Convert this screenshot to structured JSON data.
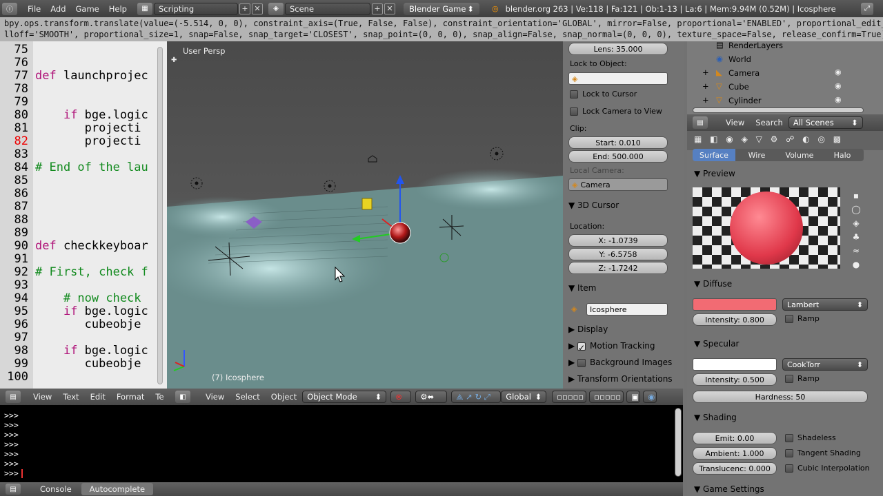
{
  "topbar": {
    "menus": [
      "File",
      "Add",
      "Game",
      "Help"
    ],
    "screen_layout": "Scripting",
    "scene": "Scene",
    "engine": "Blender Game",
    "stats": "blender.org 263 | Ve:118 | Fa:121 | Ob:1-13 | La:6 | Mem:9.94M (0.52M) | Icosphere"
  },
  "infolog": {
    "lines": [
      "bpy.ops.transform.translate(value=(-5.514, 0, 0), constraint_axis=(True, False, False), constraint_orientation='GLOBAL', mirror=False, proportional='ENABLED', proportional_edit_fa",
      "lloff='SMOOTH', proportional_size=1, snap=False, snap_target='CLOSEST', snap_point=(0, 0, 0), snap_align=False, snap_normal=(0, 0, 0), texture_space=False, release_confirm=True)"
    ]
  },
  "text_editor": {
    "lines": [
      {
        "n": "75",
        "code": "",
        "cls": "txt"
      },
      {
        "n": "76",
        "code": "",
        "cls": "txt"
      },
      {
        "n": "77",
        "code": "def launchprojec",
        "cls": "def"
      },
      {
        "n": "78",
        "code": "",
        "cls": "txt"
      },
      {
        "n": "79",
        "code": "",
        "cls": "txt"
      },
      {
        "n": "80",
        "code": "    if bge.logic",
        "cls": "if"
      },
      {
        "n": "81",
        "code": "       projecti",
        "cls": "txt"
      },
      {
        "n": "82",
        "code": "       projecti",
        "cls": "txt"
      },
      {
        "n": "83",
        "code": "",
        "cls": "txt"
      },
      {
        "n": "84",
        "code": "# End of the lau",
        "cls": "cm"
      },
      {
        "n": "85",
        "code": "",
        "cls": "txt"
      },
      {
        "n": "86",
        "code": "",
        "cls": "txt"
      },
      {
        "n": "87",
        "code": "",
        "cls": "txt"
      },
      {
        "n": "88",
        "code": "",
        "cls": "txt"
      },
      {
        "n": "89",
        "code": "",
        "cls": "txt"
      },
      {
        "n": "90",
        "code": "def checkkeyboar",
        "cls": "def"
      },
      {
        "n": "91",
        "code": "",
        "cls": "txt"
      },
      {
        "n": "92",
        "code": "# First, check f",
        "cls": "cm"
      },
      {
        "n": "93",
        "code": "",
        "cls": "txt"
      },
      {
        "n": "94",
        "code": "    # now check",
        "cls": "cm"
      },
      {
        "n": "95",
        "code": "    if bge.logic",
        "cls": "if"
      },
      {
        "n": "96",
        "code": "       cubeobje",
        "cls": "txt"
      },
      {
        "n": "97",
        "code": "",
        "cls": "txt"
      },
      {
        "n": "98",
        "code": "    if bge.logic",
        "cls": "if"
      },
      {
        "n": "99",
        "code": "       cubeobje",
        "cls": "txt"
      },
      {
        "n": "100",
        "code": "",
        "cls": "txt"
      }
    ],
    "error_line": "82",
    "header_menus": [
      "View",
      "Text",
      "Edit",
      "Format",
      "Te"
    ]
  },
  "viewport": {
    "label": "User Persp",
    "object_label": "(7) Icosphere",
    "header_menus": [
      "View",
      "Select",
      "Object"
    ],
    "mode": "Object Mode",
    "orientation": "Global"
  },
  "npanel": {
    "lens": "Lens: 35.000",
    "lock_to_object": "Lock to Object:",
    "lock_to_cursor": "Lock to Cursor",
    "lock_camera": "Lock Camera to View",
    "clip": "Clip:",
    "clip_start": "Start: 0.010",
    "clip_end": "End: 500.000",
    "local_camera": "Local Camera:",
    "camera": "Camera",
    "cursor_header": "3D Cursor",
    "location": "Location:",
    "x": "X: -1.0739",
    "y": "Y: -6.5758",
    "z": "Z: -1.7242",
    "item_header": "Item",
    "item_name": "Icosphere",
    "display": "Display",
    "motion_tracking": "Motion Tracking",
    "background_images": "Background Images",
    "transform_orientations": "Transform Orientations"
  },
  "outliner": {
    "rows": [
      "RenderLayers",
      "World",
      "Camera",
      "Cube",
      "Cylinder"
    ],
    "header_menus": [
      "View",
      "Search"
    ],
    "filter": "All Scenes"
  },
  "properties": {
    "tabs": [
      "Surface",
      "Wire",
      "Volume",
      "Halo"
    ],
    "preview": "Preview",
    "diffuse": "Diffuse",
    "diffuse_color": "#f26b73",
    "diffuse_shader": "Lambert",
    "diffuse_intensity": "Intensity: 0.800",
    "ramp": "Ramp",
    "specular": "Specular",
    "specular_shader": "CookTorr",
    "specular_intensity": "Intensity: 0.500",
    "hardness": "Hardness: 50",
    "shading": "Shading",
    "emit": "Emit: 0.00",
    "ambient": "Ambient: 1.000",
    "translucency": "Translucenc: 0.000",
    "shadeless": "Shadeless",
    "tangent_shading": "Tangent Shading",
    "cubic_interpolation": "Cubic Interpolation",
    "game_settings": "Game Settings"
  },
  "console": {
    "prompts": [
      ">>>",
      ">>>",
      ">>>",
      ">>>",
      ">>>",
      ">>>",
      ">>>"
    ],
    "tabs": [
      "Console",
      "Autocomplete"
    ]
  }
}
